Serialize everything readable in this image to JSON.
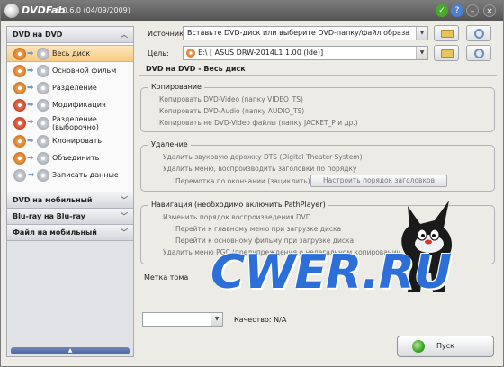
{
  "title": {
    "brand": "DVDFab",
    "version": "6.0.6.0 (04/09/2009)"
  },
  "titlebar_icons": [
    "check-icon",
    "help-icon",
    "minimize-icon",
    "close-icon"
  ],
  "sidebar": {
    "header": "DVD на DVD",
    "items": [
      {
        "label": "Весь диск",
        "selected": true,
        "icon": "disc-copy-icon"
      },
      {
        "label": "Основной фильм",
        "selected": false,
        "icon": "disc-copy-icon"
      },
      {
        "label": "Разделение",
        "selected": false,
        "icon": "disc-copy-icon"
      },
      {
        "label": "Модификация",
        "selected": false,
        "icon": "disc-copy-icon"
      },
      {
        "label": "Разделение (выборочно)",
        "selected": false,
        "icon": "disc-copy-icon"
      },
      {
        "label": "Клонировать",
        "selected": false,
        "icon": "disc-copy-icon"
      },
      {
        "label": "Объединить",
        "selected": false,
        "icon": "disc-copy-icon"
      },
      {
        "label": "Записать данные",
        "selected": false,
        "icon": "disc-burn-icon"
      }
    ],
    "sections": [
      {
        "label": "DVD на мобильный"
      },
      {
        "label": "Blu-ray на Blu-ray"
      },
      {
        "label": "Файл на мобильный"
      }
    ]
  },
  "source": {
    "label": "Источник:",
    "value": "Вставьте DVD-диск или выберите DVD-папку/файл образа"
  },
  "target": {
    "label": "Цель:",
    "value": "E:\\ [ ASUS DRW-2014L1 1.00 (Ide)]"
  },
  "section_title": "DVD на DVD - Весь диск",
  "copy_group": {
    "title": "Копирование",
    "options": [
      "Копировать DVD-Video (папку VIDEO_TS)",
      "Копировать DVD-Audio (папку AUDIO_TS)",
      "Копировать не DVD-Video файлы (папку JACKET_P и др.)"
    ]
  },
  "remove_group": {
    "title": "Удаление",
    "options": [
      "Удалить звуковую дорожку DTS (Digital Theater System)",
      "Удалить меню, воспроизводить заголовки по порядку",
      "Перемотка по окончании (зациклить)"
    ],
    "button": "Настроить порядок заголовков"
  },
  "nav_group": {
    "title": "Навигация (необходимо включить PathPlayer)",
    "options": [
      "Изменить порядок воспроизведения DVD",
      "Перейти к главному меню при загрузке диска",
      "Перейти к основному фильму при загрузке диска",
      "Удалить меню PGC (предупреждения о нелегальном копировании...)"
    ]
  },
  "volume_label": {
    "label": "Метка тома"
  },
  "quality": {
    "label": "Качество: N/A"
  },
  "start_button": {
    "label": "Пуск"
  },
  "watermark": "CWER.RU"
}
